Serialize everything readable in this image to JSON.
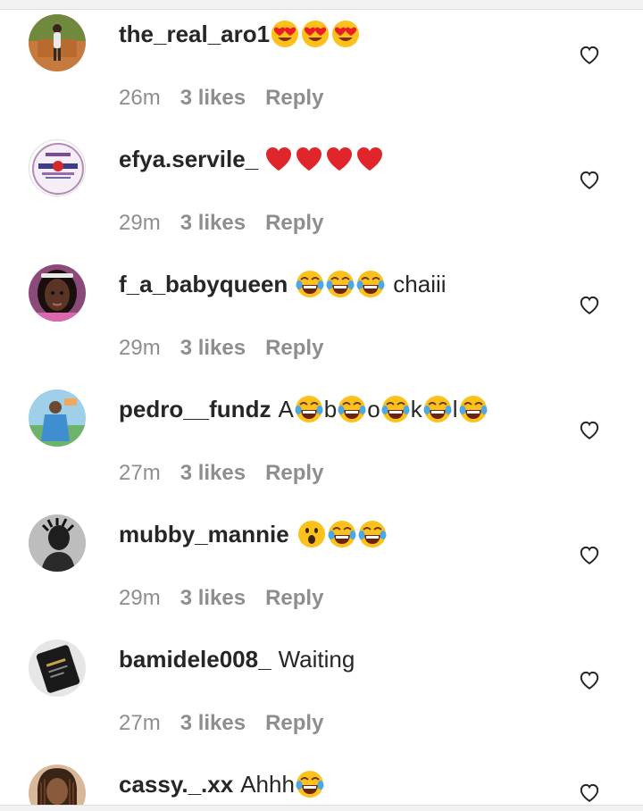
{
  "comments": [
    {
      "username": "the_real_aro1",
      "text": "",
      "emoji": [
        "heart-eyes",
        "heart-eyes",
        "heart-eyes"
      ],
      "time": "26m",
      "likes": "3 likes",
      "reply": "Reply"
    },
    {
      "username": "efya.servile_",
      "text": "",
      "emoji": [
        "red-heart",
        "red-heart",
        "red-heart",
        "red-heart"
      ],
      "time": "29m",
      "likes": "3 likes",
      "reply": "Reply"
    },
    {
      "username": "f_a_babyqueen",
      "text": "chaiii",
      "emoji": [
        "tears-of-joy",
        "tears-of-joy",
        "tears-of-joy"
      ],
      "time": "29m",
      "likes": "3 likes",
      "reply": "Reply"
    },
    {
      "username": "pedro__fundz",
      "text": "A b o k l",
      "emoji": [
        "tears-of-joy",
        "tears-of-joy",
        "tears-of-joy",
        "tears-of-joy",
        "tears-of-joy"
      ],
      "time": "27m",
      "likes": "3 likes",
      "reply": "Reply"
    },
    {
      "username": "mubby_mannie",
      "text": "",
      "emoji": [
        "astonished",
        "tears-of-joy",
        "tears-of-joy"
      ],
      "time": "29m",
      "likes": "3 likes",
      "reply": "Reply"
    },
    {
      "username": "bamidele008_",
      "text": "Waiting",
      "emoji": [],
      "time": "27m",
      "likes": "3 likes",
      "reply": "Reply"
    },
    {
      "username": "cassy._.xx",
      "text": "Ahhh",
      "emoji": [
        "tears-of-joy"
      ],
      "time": "",
      "likes": "",
      "reply": ""
    }
  ],
  "icons": {
    "like": "heart-outline-icon"
  },
  "colors": {
    "text": "#262626",
    "meta": "#8e8e8e",
    "icon": "#262626"
  }
}
